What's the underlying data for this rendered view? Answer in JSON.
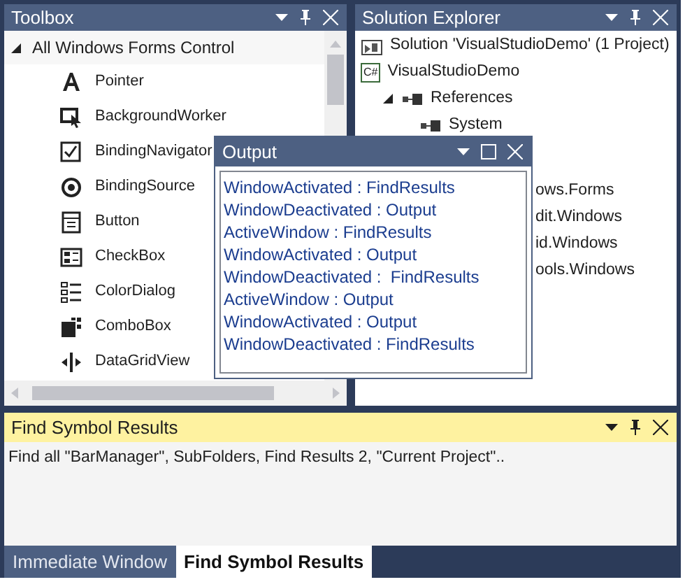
{
  "toolbox": {
    "title": "Toolbox",
    "category": {
      "label": "All Windows Forms Control",
      "expanded": true
    },
    "items": [
      {
        "label": "Pointer"
      },
      {
        "label": "BackgroundWorker"
      },
      {
        "label": "BindingNavigator"
      },
      {
        "label": "BindingSource"
      },
      {
        "label": "Button"
      },
      {
        "label": "CheckBox"
      },
      {
        "label": "ColorDialog"
      },
      {
        "label": "ComboBox"
      },
      {
        "label": "DataGridView"
      }
    ]
  },
  "solution_explorer": {
    "title": "Solution Explorer",
    "items": [
      {
        "label": "Solution 'VisualStudioDemo' (1 Project)",
        "kind": "solution"
      },
      {
        "label": "VisualStudioDemo",
        "kind": "project",
        "badge": "C#"
      },
      {
        "label": "References",
        "kind": "reference",
        "expanded": true,
        "children": [
          {
            "label": "System",
            "kind": "reference"
          },
          {
            "label": "ows.Forms",
            "kind": "covered"
          },
          {
            "label": "dit.Windows",
            "kind": "covered"
          },
          {
            "label": "id.Windows",
            "kind": "covered"
          },
          {
            "label": "ools.Windows",
            "kind": "covered"
          }
        ]
      }
    ]
  },
  "output": {
    "title": "Output",
    "lines": [
      "WindowActivated : FindResults",
      "WindowDeactivated : Output",
      "ActiveWindow : FindResults",
      "WindowActivated : Output",
      "WindowDeactivated :  FindResults",
      "ActiveWindow : Output",
      "WindowActivated : Output",
      "WindowDeactivated : FindResults"
    ]
  },
  "find_results": {
    "title": "Find Symbol Results",
    "text": "Find all \"BarManager\", SubFolders, Find Results 2, \"Current Project\".."
  },
  "tabs": [
    {
      "label": "Immediate Window",
      "selected": false
    },
    {
      "label": "Find Symbol Results",
      "selected": true
    }
  ]
}
